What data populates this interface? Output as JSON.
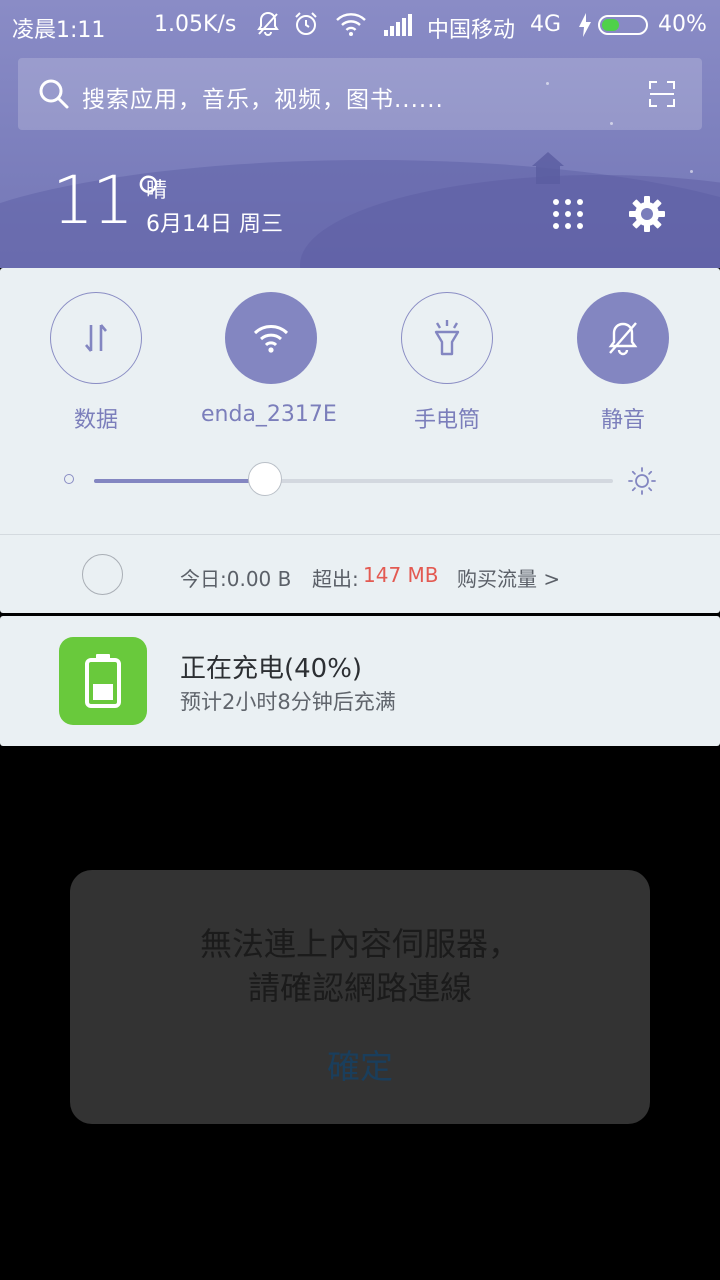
{
  "status_bar": {
    "time": "凌晨1:11",
    "speed": "1.05K/s",
    "carrier": "中国移动",
    "network": "4G",
    "battery_percent": "40%",
    "battery_level": 0.4,
    "battery_color": "#4fd14a"
  },
  "search": {
    "placeholder": "搜索应用，音乐，视频，图书......"
  },
  "weather": {
    "temperature": "11°",
    "condition": "晴",
    "date": "6月14日 周三"
  },
  "quick_settings": {
    "toggles": [
      {
        "label": "数据",
        "icon": "data-arrows-icon",
        "active": false
      },
      {
        "label": "enda_2317E",
        "icon": "wifi-icon",
        "active": true
      },
      {
        "label": "手电筒",
        "icon": "flashlight-icon",
        "active": false
      },
      {
        "label": "静音",
        "icon": "bell-mute-icon",
        "active": true
      }
    ],
    "brightness_level": 0.33,
    "accent_color": "#8386c1"
  },
  "data_usage": {
    "today": "今日:0.00 B",
    "exceed_label": "超出:",
    "exceed_value": "147 MB",
    "buy_link": "购买流量 >"
  },
  "notification": {
    "title": "正在充电(40%)",
    "subtitle": "预计2小时8分钟后充满",
    "icon_color": "#69c93c"
  },
  "dialog": {
    "message_line1": "無法連上內容伺服器，",
    "message_line2": "請確認網路連線",
    "confirm_label": "確定"
  }
}
